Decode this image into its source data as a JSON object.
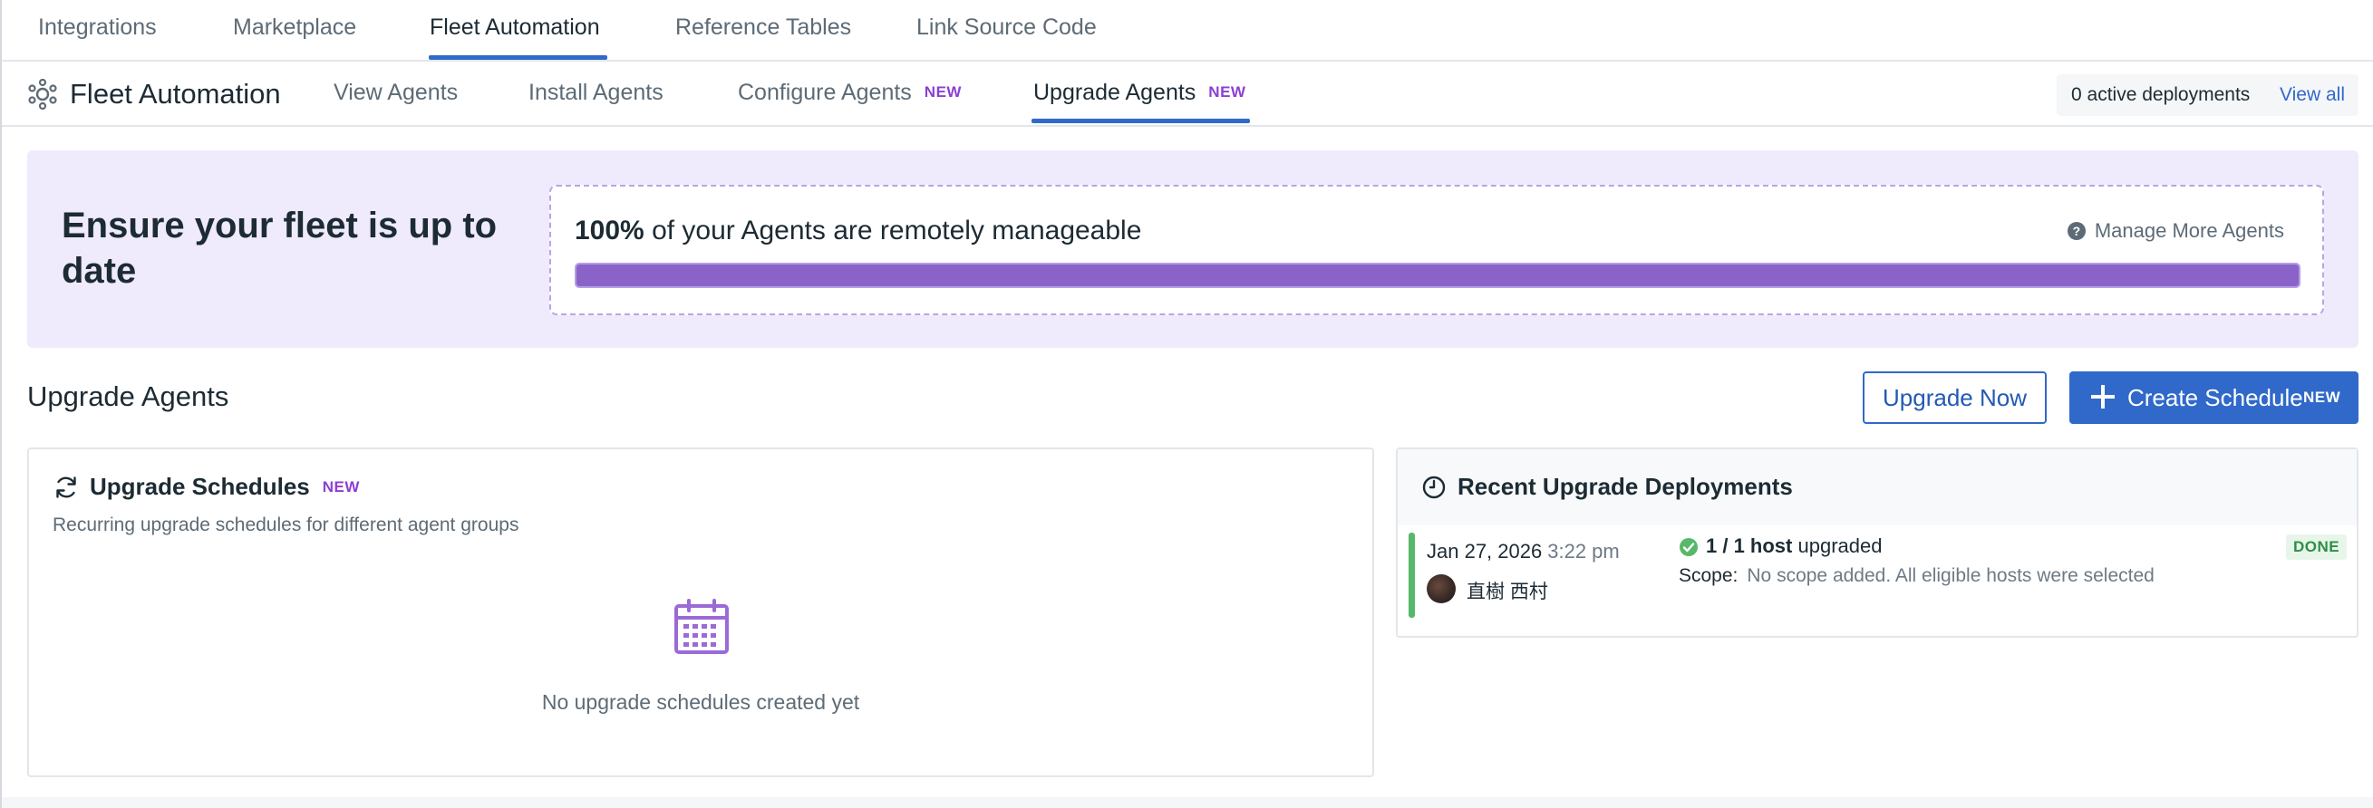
{
  "top_nav": {
    "tabs": [
      {
        "label": "Integrations",
        "active": false
      },
      {
        "label": "Marketplace",
        "active": false
      },
      {
        "label": "Fleet Automation",
        "active": true
      },
      {
        "label": "Reference Tables",
        "active": false
      },
      {
        "label": "Link Source Code",
        "active": false
      }
    ]
  },
  "sub_nav": {
    "title": "Fleet Automation",
    "icon": "gear-network-icon",
    "tabs": [
      {
        "label": "View Agents",
        "badge": "",
        "active": false
      },
      {
        "label": "Install Agents",
        "badge": "",
        "active": false
      },
      {
        "label": "Configure Agents",
        "badge": "NEW",
        "active": false
      },
      {
        "label": "Upgrade Agents",
        "badge": "NEW",
        "active": true
      }
    ],
    "deployments": {
      "count_text": "0 active deployments",
      "view_all": "View all"
    }
  },
  "banner": {
    "headline": "Ensure your fleet is up to date",
    "percent": "100%",
    "percent_text": "of your Agents are remotely manageable",
    "progress_fraction": 1.0,
    "manage_more": "Manage More Agents"
  },
  "section": {
    "title": "Upgrade Agents",
    "upgrade_now": "Upgrade Now",
    "create_schedule": "Create Schedule",
    "create_badge": "NEW"
  },
  "schedules": {
    "title": "Upgrade Schedules",
    "badge": "NEW",
    "description": "Recurring upgrade schedules for different agent groups",
    "empty_text": "No upgrade schedules created yet"
  },
  "recent": {
    "title": "Recent Upgrade Deployments",
    "deployments": [
      {
        "date": "Jan 27, 2026",
        "time": "3:22 pm",
        "user": "直樹 西村",
        "hosts": "1 / 1 host",
        "hosts_suffix": "upgraded",
        "scope_label": "Scope:",
        "scope_value": "No scope added. All eligible hosts were selected",
        "status": "DONE"
      }
    ]
  },
  "colors": {
    "accent": "#3069c9",
    "badge_purple": "#8b3fd4",
    "banner_bg": "#efeafc",
    "progress": "#8a63c9",
    "success": "#57b86a"
  }
}
